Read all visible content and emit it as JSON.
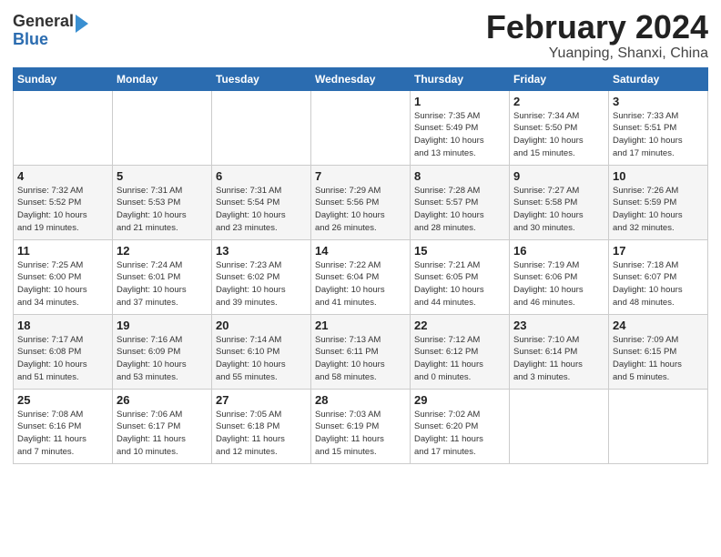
{
  "header": {
    "logo_general": "General",
    "logo_blue": "Blue",
    "month_title": "February 2024",
    "location": "Yuanping, Shanxi, China"
  },
  "weekdays": [
    "Sunday",
    "Monday",
    "Tuesday",
    "Wednesday",
    "Thursday",
    "Friday",
    "Saturday"
  ],
  "weeks": [
    [
      {
        "day": "",
        "info": ""
      },
      {
        "day": "",
        "info": ""
      },
      {
        "day": "",
        "info": ""
      },
      {
        "day": "",
        "info": ""
      },
      {
        "day": "1",
        "info": "Sunrise: 7:35 AM\nSunset: 5:49 PM\nDaylight: 10 hours\nand 13 minutes."
      },
      {
        "day": "2",
        "info": "Sunrise: 7:34 AM\nSunset: 5:50 PM\nDaylight: 10 hours\nand 15 minutes."
      },
      {
        "day": "3",
        "info": "Sunrise: 7:33 AM\nSunset: 5:51 PM\nDaylight: 10 hours\nand 17 minutes."
      }
    ],
    [
      {
        "day": "4",
        "info": "Sunrise: 7:32 AM\nSunset: 5:52 PM\nDaylight: 10 hours\nand 19 minutes."
      },
      {
        "day": "5",
        "info": "Sunrise: 7:31 AM\nSunset: 5:53 PM\nDaylight: 10 hours\nand 21 minutes."
      },
      {
        "day": "6",
        "info": "Sunrise: 7:31 AM\nSunset: 5:54 PM\nDaylight: 10 hours\nand 23 minutes."
      },
      {
        "day": "7",
        "info": "Sunrise: 7:29 AM\nSunset: 5:56 PM\nDaylight: 10 hours\nand 26 minutes."
      },
      {
        "day": "8",
        "info": "Sunrise: 7:28 AM\nSunset: 5:57 PM\nDaylight: 10 hours\nand 28 minutes."
      },
      {
        "day": "9",
        "info": "Sunrise: 7:27 AM\nSunset: 5:58 PM\nDaylight: 10 hours\nand 30 minutes."
      },
      {
        "day": "10",
        "info": "Sunrise: 7:26 AM\nSunset: 5:59 PM\nDaylight: 10 hours\nand 32 minutes."
      }
    ],
    [
      {
        "day": "11",
        "info": "Sunrise: 7:25 AM\nSunset: 6:00 PM\nDaylight: 10 hours\nand 34 minutes."
      },
      {
        "day": "12",
        "info": "Sunrise: 7:24 AM\nSunset: 6:01 PM\nDaylight: 10 hours\nand 37 minutes."
      },
      {
        "day": "13",
        "info": "Sunrise: 7:23 AM\nSunset: 6:02 PM\nDaylight: 10 hours\nand 39 minutes."
      },
      {
        "day": "14",
        "info": "Sunrise: 7:22 AM\nSunset: 6:04 PM\nDaylight: 10 hours\nand 41 minutes."
      },
      {
        "day": "15",
        "info": "Sunrise: 7:21 AM\nSunset: 6:05 PM\nDaylight: 10 hours\nand 44 minutes."
      },
      {
        "day": "16",
        "info": "Sunrise: 7:19 AM\nSunset: 6:06 PM\nDaylight: 10 hours\nand 46 minutes."
      },
      {
        "day": "17",
        "info": "Sunrise: 7:18 AM\nSunset: 6:07 PM\nDaylight: 10 hours\nand 48 minutes."
      }
    ],
    [
      {
        "day": "18",
        "info": "Sunrise: 7:17 AM\nSunset: 6:08 PM\nDaylight: 10 hours\nand 51 minutes."
      },
      {
        "day": "19",
        "info": "Sunrise: 7:16 AM\nSunset: 6:09 PM\nDaylight: 10 hours\nand 53 minutes."
      },
      {
        "day": "20",
        "info": "Sunrise: 7:14 AM\nSunset: 6:10 PM\nDaylight: 10 hours\nand 55 minutes."
      },
      {
        "day": "21",
        "info": "Sunrise: 7:13 AM\nSunset: 6:11 PM\nDaylight: 10 hours\nand 58 minutes."
      },
      {
        "day": "22",
        "info": "Sunrise: 7:12 AM\nSunset: 6:12 PM\nDaylight: 11 hours\nand 0 minutes."
      },
      {
        "day": "23",
        "info": "Sunrise: 7:10 AM\nSunset: 6:14 PM\nDaylight: 11 hours\nand 3 minutes."
      },
      {
        "day": "24",
        "info": "Sunrise: 7:09 AM\nSunset: 6:15 PM\nDaylight: 11 hours\nand 5 minutes."
      }
    ],
    [
      {
        "day": "25",
        "info": "Sunrise: 7:08 AM\nSunset: 6:16 PM\nDaylight: 11 hours\nand 7 minutes."
      },
      {
        "day": "26",
        "info": "Sunrise: 7:06 AM\nSunset: 6:17 PM\nDaylight: 11 hours\nand 10 minutes."
      },
      {
        "day": "27",
        "info": "Sunrise: 7:05 AM\nSunset: 6:18 PM\nDaylight: 11 hours\nand 12 minutes."
      },
      {
        "day": "28",
        "info": "Sunrise: 7:03 AM\nSunset: 6:19 PM\nDaylight: 11 hours\nand 15 minutes."
      },
      {
        "day": "29",
        "info": "Sunrise: 7:02 AM\nSunset: 6:20 PM\nDaylight: 11 hours\nand 17 minutes."
      },
      {
        "day": "",
        "info": ""
      },
      {
        "day": "",
        "info": ""
      }
    ]
  ]
}
